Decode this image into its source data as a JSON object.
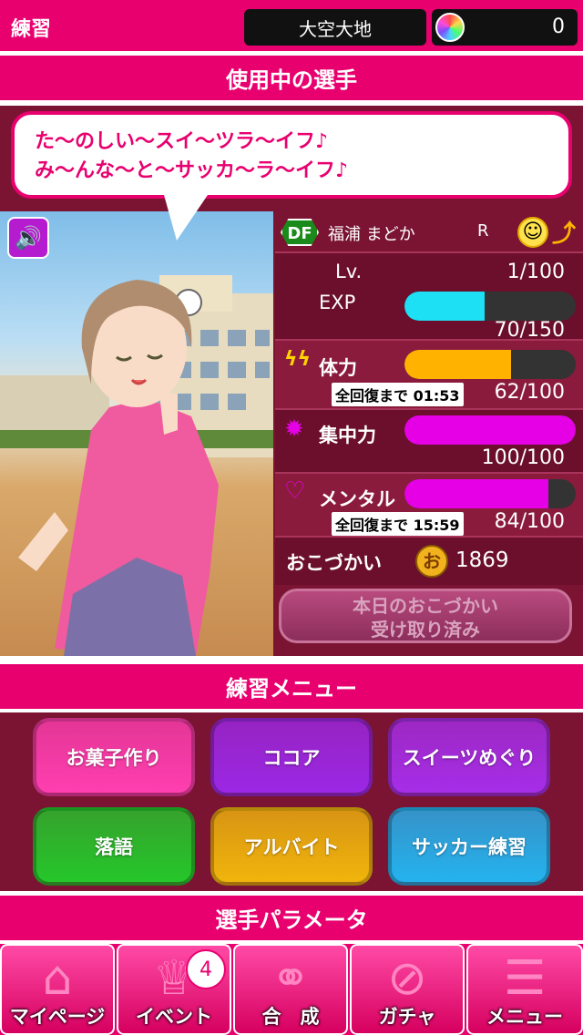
{
  "header": {
    "screen_title": "練習",
    "team_name": "大空大地",
    "gem_count": "0"
  },
  "sections": {
    "current_player": "使用中の選手",
    "practice_menu": "練習メニュー",
    "player_params": "選手パラメータ"
  },
  "speech": {
    "line1": "た〜のしい〜スイ〜ツラ〜イフ♪",
    "line2": "み〜んな〜と〜サッカ〜ラ〜イフ♪"
  },
  "player": {
    "position": "DF",
    "name": "福浦 まどか",
    "rarity": "R",
    "level_label": "Lv.",
    "level": "1/100",
    "exp_label": "EXP",
    "exp": "70/150",
    "exp_ratio": 0.4667,
    "stamina_label": "体力",
    "stamina_timer": "全回復まで 01:53",
    "stamina": "62/100",
    "stamina_ratio": 0.62,
    "focus_label": "集中力",
    "focus": "100/100",
    "focus_ratio": 1.0,
    "mental_label": "メンタル",
    "mental_timer": "全回復まで 15:59",
    "mental": "84/100",
    "mental_ratio": 0.84,
    "allowance_label": "おこづかい",
    "allowance_coin": "お",
    "allowance": "1869",
    "receive_line1": "本日のおこづかい",
    "receive_line2": "受け取り済み"
  },
  "practice": [
    {
      "label": "お菓子作り",
      "color": "#ff3fb0"
    },
    {
      "label": "ココア",
      "color": "#9c28e6"
    },
    {
      "label": "スイーツめぐり",
      "color": "#a62ee8"
    },
    {
      "label": "落語",
      "color": "#25c72b"
    },
    {
      "label": "アルバイト",
      "color": "#f0b50c"
    },
    {
      "label": "サッカー練習",
      "color": "#24b3ef"
    }
  ],
  "nav": [
    {
      "label": "マイページ",
      "icon": "home-icon"
    },
    {
      "label": "イベント",
      "icon": "trophy-icon",
      "badge": "4"
    },
    {
      "label": "合　成",
      "icon": "handshake-icon"
    },
    {
      "label": "ガチャ",
      "icon": "ball-icon"
    },
    {
      "label": "メニュー",
      "icon": "menu-icon"
    }
  ],
  "colors": {
    "accent": "#e8006f",
    "panel": "#7a1432",
    "exp_bar": "#1ee0f5",
    "stamina_bar": "#ffb300",
    "focus_bar": "#e600e6",
    "mental_bar": "#e600e6"
  }
}
